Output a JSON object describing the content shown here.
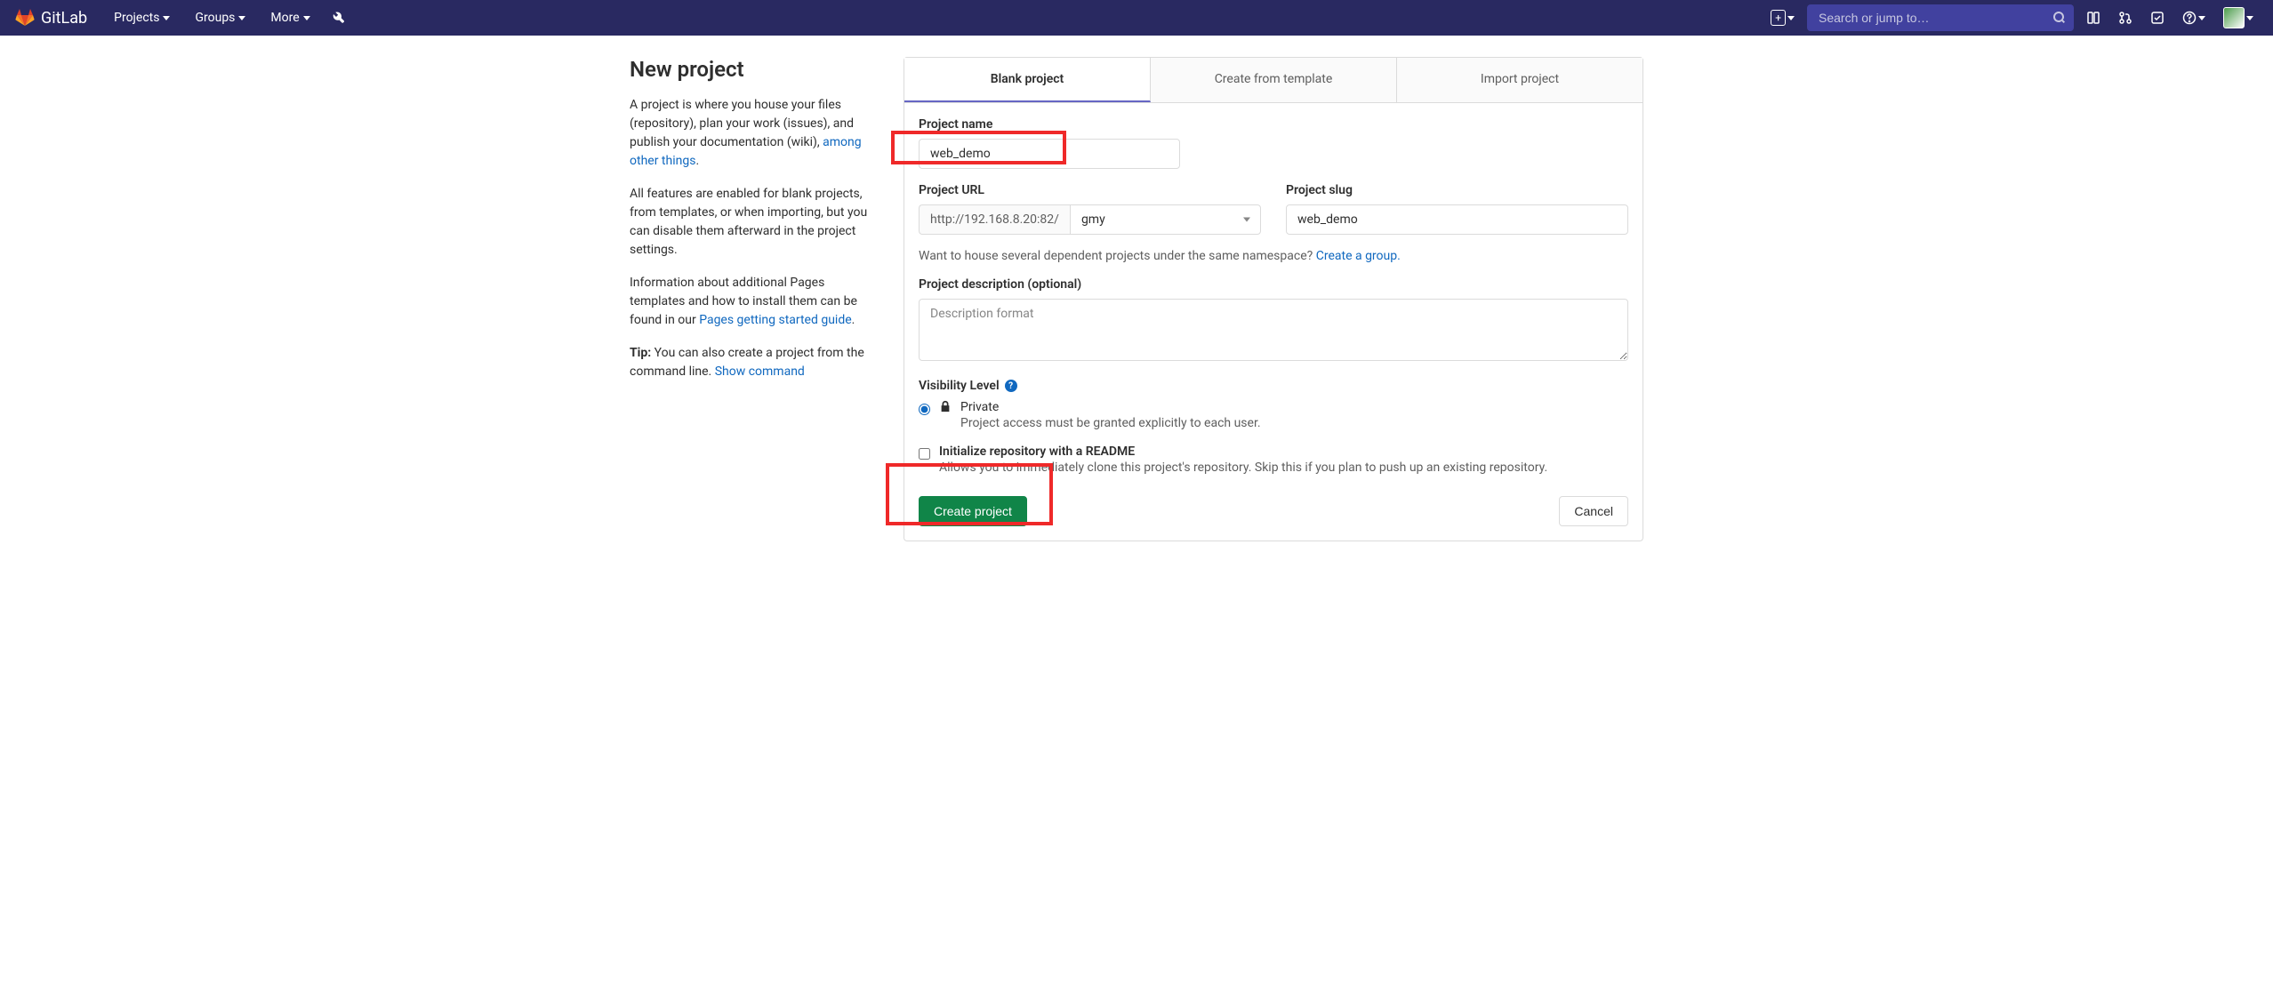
{
  "header": {
    "brand": "GitLab",
    "nav": {
      "projects": "Projects",
      "groups": "Groups",
      "more": "More"
    },
    "search_placeholder": "Search or jump to…"
  },
  "sidebar": {
    "title": "New project",
    "p1_a": "A project is where you house your files (repository), plan your work (issues), and publish your documentation (wiki), ",
    "p1_link": "among other things",
    "p1_b": ".",
    "p2": "All features are enabled for blank projects, from templates, or when importing, but you can disable them afterward in the project settings.",
    "p3_a": "Information about additional Pages templates and how to install them can be found in our ",
    "p3_link": "Pages getting started guide",
    "p3_b": ".",
    "p4_tip": "Tip:",
    "p4_a": " You can also create a project from the command line. ",
    "p4_link": "Show command"
  },
  "tabs": {
    "blank": "Blank project",
    "template": "Create from template",
    "import": "Import project"
  },
  "form": {
    "name_label": "Project name",
    "name_value": "web_demo",
    "url_label": "Project URL",
    "url_prefix": "http://192.168.8.20:82/",
    "url_namespace": "gmy",
    "slug_label": "Project slug",
    "slug_value": "web_demo",
    "namespace_hint_a": "Want to house several dependent projects under the same namespace? ",
    "namespace_hint_link": "Create a group.",
    "desc_label": "Project description (optional)",
    "desc_placeholder": "Description format",
    "visibility_label": "Visibility Level",
    "private_title": "Private",
    "private_desc": "Project access must be granted explicitly to each user.",
    "readme_title": "Initialize repository with a README",
    "readme_desc": "Allows you to immediately clone this project's repository. Skip this if you plan to push up an existing repository.",
    "create_btn": "Create project",
    "cancel_btn": "Cancel"
  }
}
